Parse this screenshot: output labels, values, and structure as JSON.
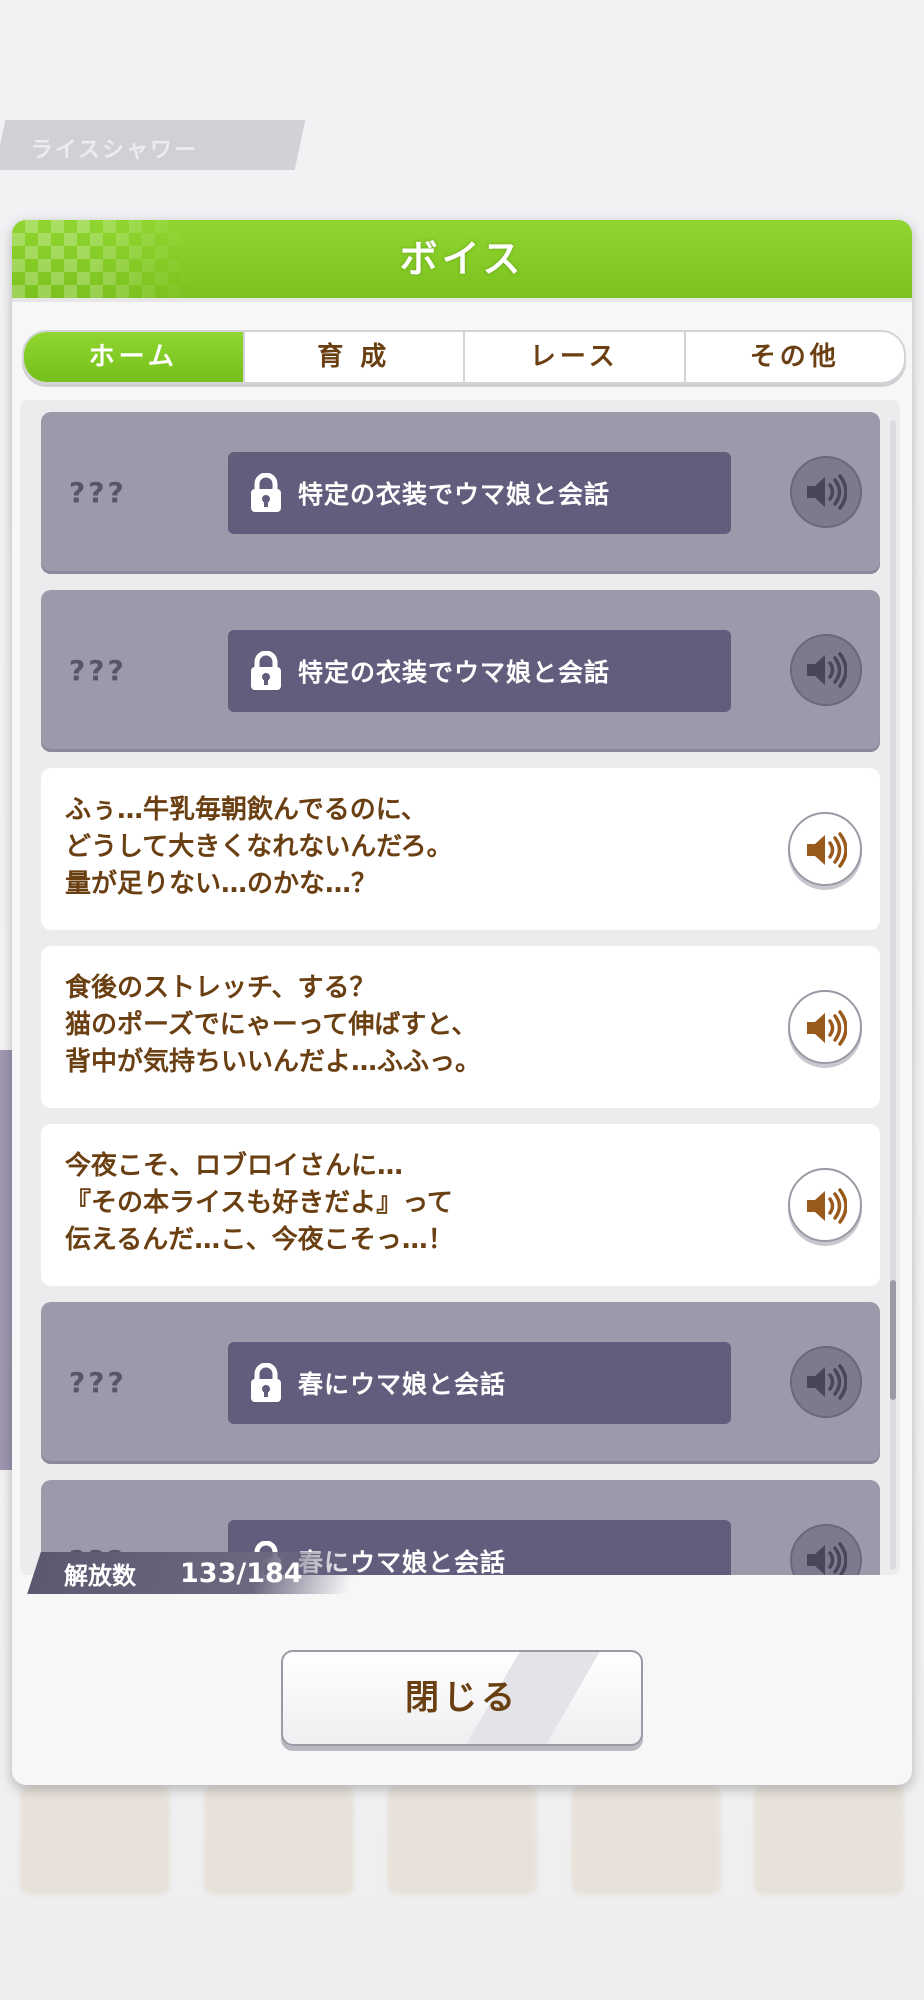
{
  "background": {
    "tag_label": "ライスシャワー"
  },
  "dialog": {
    "title": "ボイス",
    "tabs": [
      {
        "label": "ホーム",
        "active": true
      },
      {
        "label": "育 成",
        "active": false
      },
      {
        "label": "レース",
        "active": false
      },
      {
        "label": "その他",
        "active": false
      }
    ],
    "items": [
      {
        "state": "locked",
        "name": "???",
        "condition": "特定の衣装でウマ娘と会話"
      },
      {
        "state": "locked",
        "name": "???",
        "condition": "特定の衣装でウマ娘と会話"
      },
      {
        "state": "unlocked",
        "text": "ふぅ…牛乳毎朝飲んでるのに、\nどうして大きくなれないんだろ。\n量が足りない…のかな…？"
      },
      {
        "state": "unlocked",
        "text": "食後のストレッチ、する？\n猫のポーズでにゃーって伸ばすと、\n背中が気持ちいいんだよ…ふふっ。"
      },
      {
        "state": "unlocked",
        "text": "今夜こそ、ロブロイさんに…\n『その本ライスも好きだよ』って\n伝えるんだ…こ、今夜こそっ…！"
      },
      {
        "state": "locked",
        "name": "???",
        "condition": "春にウマ娘と会話"
      },
      {
        "state": "locked",
        "name": "???",
        "condition": "春にウマ娘と会話"
      }
    ],
    "counter": {
      "label": "解放数",
      "value": "133/184"
    },
    "close_label": "閉じる"
  },
  "colors": {
    "accent_green": "#7cc21e",
    "locked_card": "#9c9aaa",
    "lock_bar": "#625d7c",
    "text_brown": "#6a3f12"
  },
  "icons": {
    "lock": "lock-icon",
    "speaker": "speaker-icon"
  }
}
